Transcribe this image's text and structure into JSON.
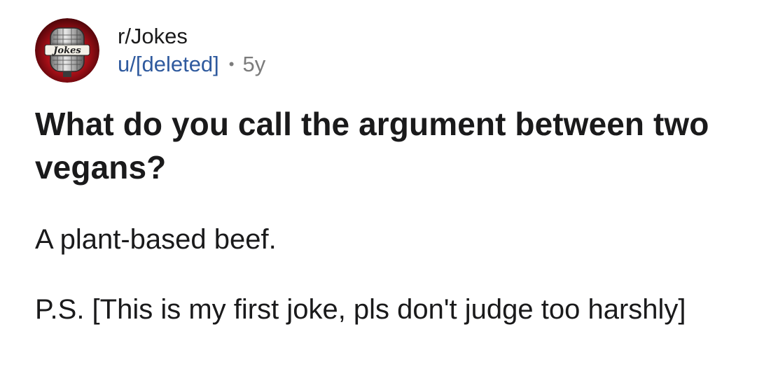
{
  "post": {
    "subreddit": "r/Jokes",
    "author": "u/[deleted]",
    "separator": "•",
    "age": "5y",
    "avatar_icon": "microphone-icon",
    "avatar_label": "Jokes",
    "title": "What do you call the argument between two vegans?",
    "body": [
      "A plant-based beef.",
      "P.S. [This is my first joke, pls don't judge too harshly]"
    ]
  },
  "colors": {
    "text": "#1a1a1b",
    "username": "#2f5a9e",
    "muted": "#7c7c7c",
    "avatar_red": "#b3121b"
  }
}
